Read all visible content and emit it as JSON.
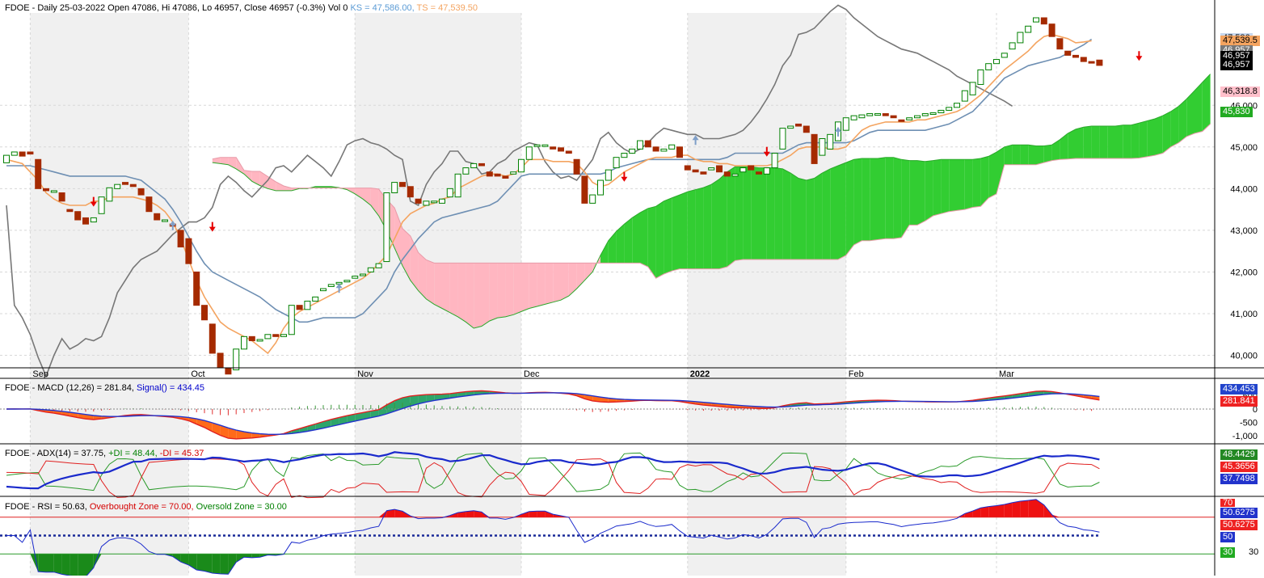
{
  "colors": {
    "up_candle": "#008000",
    "down_candle": "#a52a00",
    "cloud_bull": "#32cd32",
    "cloud_bear": "#ffb6c1",
    "kijun": "#6e8fb3",
    "tenkan": "#f4a460",
    "chikou": "#777777",
    "grid": "#d8d8d8",
    "shade": "#f0f0f0"
  },
  "price_panel": {
    "title_main": "FDOE - Daily 25-03-2022 Open 47086, Hi 47086, Lo 46957, Close 46957 (-0.3%) Vol 0",
    "title_ks": "KS = 47,586.00,",
    "title_ts": "TS = 47,539.50",
    "price_tags": [
      {
        "text": "47,586",
        "bg": "#c8d8ee",
        "fg": "#000000",
        "value": 47586
      },
      {
        "text": "47,539.5",
        "bg": "#f4a460",
        "fg": "#000000",
        "value": 47539.5
      },
      {
        "text": "46,957",
        "bg": "#777777",
        "fg": "#ffffff",
        "value": 47310
      },
      {
        "text": "46,957",
        "bg": "#000000",
        "fg": "#ffffff",
        "value": 47170
      },
      {
        "text": "46,957",
        "bg": "#000000",
        "fg": "#ffffff",
        "value": 46957
      },
      {
        "text": "46,318.8",
        "bg": "#ffc0cb",
        "fg": "#000000",
        "value": 46318.8
      },
      {
        "text": "45,830",
        "bg": "#22aa22",
        "fg": "#ffffff",
        "value": 45830
      }
    ]
  },
  "macd_panel": {
    "name": "FDOE - MACD (12,26) = 281.84,",
    "signal": "Signal() = 434.45",
    "tags": [
      "434.453",
      "281.841"
    ],
    "ticks": [
      "500",
      "0",
      "-500",
      "-1,000"
    ]
  },
  "adx_panel": {
    "name": "FDOE - ADX(14) = 37.75,",
    "pdi": "+DI = 48.44,",
    "mdi": "-DI = 45.37",
    "tags": [
      "48.4429",
      "45.3656",
      "37.7498"
    ]
  },
  "rsi_panel": {
    "name": "FDOE - RSI = 50.63,",
    "ob": "Overbought Zone = 70.00,",
    "os": "Oversold Zone = 30.00",
    "tags": [
      "70",
      "50.6275",
      "50.6275",
      "50",
      "30"
    ],
    "tick_30": "30"
  },
  "chart_data": {
    "type": "candlestick",
    "symbol": "FDOE",
    "interval": "Daily",
    "x_tick_labels": [
      "Sep",
      "Oct",
      "Nov",
      "Dec",
      "2022",
      "Feb",
      "Mar"
    ],
    "y_tick_labels": [
      "40,000",
      "41,000",
      "42,000",
      "43,000",
      "44,000",
      "45,000",
      "46,000"
    ],
    "ylim": [
      39700,
      48100
    ],
    "candles": [
      {
        "o": 44620,
        "c": 44800
      },
      {
        "o": 44800,
        "c": 44880
      },
      {
        "o": 44880,
        "c": 44780
      },
      {
        "o": 44880,
        "c": 44830
      },
      {
        "o": 44700,
        "c": 44000
      },
      {
        "o": 44000,
        "c": 43950
      },
      {
        "o": 43950,
        "c": 43950
      },
      {
        "o": 43900,
        "c": 43700
      },
      {
        "o": 43500,
        "c": 43450
      },
      {
        "o": 43450,
        "c": 43250
      },
      {
        "o": 43300,
        "c": 43150
      },
      {
        "o": 43200,
        "c": 43300
      },
      {
        "o": 43400,
        "c": 43800
      },
      {
        "o": 43700,
        "c": 44020
      },
      {
        "o": 44000,
        "c": 44100
      },
      {
        "o": 44150,
        "c": 44100
      },
      {
        "o": 44100,
        "c": 44050
      },
      {
        "o": 44000,
        "c": 43850
      },
      {
        "o": 43800,
        "c": 43450
      },
      {
        "o": 43400,
        "c": 43250
      },
      {
        "o": 43250,
        "c": 43250
      },
      {
        "o": 43150,
        "c": 43100
      },
      {
        "o": 43000,
        "c": 42600
      },
      {
        "o": 42800,
        "c": 42200
      },
      {
        "o": 42000,
        "c": 41200
      },
      {
        "o": 41200,
        "c": 40850
      },
      {
        "o": 40750,
        "c": 40050
      },
      {
        "o": 40050,
        "c": 39700
      },
      {
        "o": 39700,
        "c": 39550
      },
      {
        "o": 39650,
        "c": 40150
      },
      {
        "o": 40150,
        "c": 40450
      },
      {
        "o": 40450,
        "c": 40350
      },
      {
        "o": 40350,
        "c": 40380
      },
      {
        "o": 40400,
        "c": 40500
      },
      {
        "o": 40500,
        "c": 40450
      },
      {
        "o": 40450,
        "c": 40500
      },
      {
        "o": 40500,
        "c": 41200
      },
      {
        "o": 41200,
        "c": 41100
      },
      {
        "o": 41100,
        "c": 41300
      },
      {
        "o": 41300,
        "c": 41400
      },
      {
        "o": 41550,
        "c": 41600
      },
      {
        "o": 41650,
        "c": 41700
      },
      {
        "o": 41750,
        "c": 41750
      },
      {
        "o": 41800,
        "c": 41800
      },
      {
        "o": 41850,
        "c": 41900
      },
      {
        "o": 41950,
        "c": 41950
      },
      {
        "o": 42000,
        "c": 42100
      },
      {
        "o": 42100,
        "c": 42200
      },
      {
        "o": 42250,
        "c": 43900
      },
      {
        "o": 43900,
        "c": 44150
      },
      {
        "o": 44150,
        "c": 44050
      },
      {
        "o": 44050,
        "c": 43800
      },
      {
        "o": 43750,
        "c": 43650
      },
      {
        "o": 43600,
        "c": 43700
      },
      {
        "o": 43700,
        "c": 43700
      },
      {
        "o": 43650,
        "c": 43750
      },
      {
        "o": 43800,
        "c": 44000
      },
      {
        "o": 43800,
        "c": 44350
      },
      {
        "o": 44350,
        "c": 44500
      },
      {
        "o": 44500,
        "c": 44600
      },
      {
        "o": 44600,
        "c": 44550
      },
      {
        "o": 44400,
        "c": 44300
      },
      {
        "o": 44350,
        "c": 44300
      },
      {
        "o": 44300,
        "c": 44250
      },
      {
        "o": 44350,
        "c": 44400
      },
      {
        "o": 44400,
        "c": 44700
      },
      {
        "o": 44700,
        "c": 45000
      },
      {
        "o": 45050,
        "c": 45050
      },
      {
        "o": 45050,
        "c": 45050
      },
      {
        "o": 45000,
        "c": 44950
      },
      {
        "o": 44980,
        "c": 44900
      },
      {
        "o": 44900,
        "c": 44850
      },
      {
        "o": 44700,
        "c": 44350
      },
      {
        "o": 44300,
        "c": 43650
      },
      {
        "o": 43650,
        "c": 43850
      },
      {
        "o": 43850,
        "c": 44200
      },
      {
        "o": 44200,
        "c": 44450
      },
      {
        "o": 44500,
        "c": 44750
      },
      {
        "o": 44750,
        "c": 44850
      },
      {
        "o": 44850,
        "c": 44950
      },
      {
        "o": 44950,
        "c": 45150
      },
      {
        "o": 45150,
        "c": 45000
      },
      {
        "o": 45000,
        "c": 44900
      },
      {
        "o": 44900,
        "c": 44950
      },
      {
        "o": 44950,
        "c": 45050
      },
      {
        "o": 45000,
        "c": 44750
      },
      {
        "o": 44550,
        "c": 44450
      },
      {
        "o": 44450,
        "c": 44400
      },
      {
        "o": 44400,
        "c": 44350
      },
      {
        "o": 44450,
        "c": 44500
      },
      {
        "o": 44550,
        "c": 44400
      },
      {
        "o": 44400,
        "c": 44300
      },
      {
        "o": 44300,
        "c": 44350
      },
      {
        "o": 44400,
        "c": 44500
      },
      {
        "o": 44550,
        "c": 44450
      },
      {
        "o": 44400,
        "c": 44350
      },
      {
        "o": 44350,
        "c": 44500
      },
      {
        "o": 44500,
        "c": 44850
      },
      {
        "o": 44950,
        "c": 45450
      },
      {
        "o": 45450,
        "c": 45500
      },
      {
        "o": 45550,
        "c": 45500
      },
      {
        "o": 45500,
        "c": 45350
      },
      {
        "o": 45300,
        "c": 44600
      },
      {
        "o": 44800,
        "c": 45200
      },
      {
        "o": 44950,
        "c": 45300
      },
      {
        "o": 45150,
        "c": 45600
      },
      {
        "o": 45400,
        "c": 45700
      },
      {
        "o": 45650,
        "c": 45750
      },
      {
        "o": 45700,
        "c": 45770
      },
      {
        "o": 45750,
        "c": 45800
      },
      {
        "o": 45800,
        "c": 45800
      },
      {
        "o": 45800,
        "c": 45750
      },
      {
        "o": 45750,
        "c": 45700
      },
      {
        "o": 45650,
        "c": 45620
      },
      {
        "o": 45650,
        "c": 45700
      },
      {
        "o": 45700,
        "c": 45750
      },
      {
        "o": 45750,
        "c": 45800
      },
      {
        "o": 45800,
        "c": 45820
      },
      {
        "o": 45820,
        "c": 45880
      },
      {
        "o": 45880,
        "c": 45950
      },
      {
        "o": 45950,
        "c": 46050
      },
      {
        "o": 46100,
        "c": 46350
      },
      {
        "o": 46250,
        "c": 46550
      },
      {
        "o": 46500,
        "c": 46850
      },
      {
        "o": 46850,
        "c": 47000
      },
      {
        "o": 47000,
        "c": 47100
      },
      {
        "o": 47150,
        "c": 47250
      },
      {
        "o": 47350,
        "c": 47500
      },
      {
        "o": 47500,
        "c": 47750
      },
      {
        "o": 47750,
        "c": 47900
      },
      {
        "o": 48000,
        "c": 48100
      },
      {
        "o": 48100,
        "c": 47950
      },
      {
        "o": 47950,
        "c": 47650
      },
      {
        "o": 47600,
        "c": 47350
      },
      {
        "o": 47300,
        "c": 47200
      },
      {
        "o": 47200,
        "c": 47150
      },
      {
        "o": 47150,
        "c": 47050
      },
      {
        "o": 47050,
        "c": 47020
      },
      {
        "o": 47086,
        "c": 46957
      }
    ],
    "tenkan": [
      44700,
      44650,
      44600,
      44400,
      44200,
      43900,
      43750,
      43650,
      43600,
      43600,
      43600,
      43700,
      43700,
      43800,
      43800,
      43800,
      43800,
      43750,
      43700,
      43600,
      43450,
      43200,
      42800,
      42300,
      41800,
      41400,
      41100,
      40800,
      40650,
      40550,
      40450,
      40350,
      40200,
      40050,
      40300,
      40650,
      40900,
      41050,
      41150,
      41250,
      41350,
      41450,
      41550,
      41650,
      41750,
      41850,
      42000,
      42200,
      42400,
      42800,
      43200,
      43400,
      43500,
      43600,
      43650,
      43750,
      43800,
      44000,
      44100,
      44200,
      44300,
      44350,
      44350,
      44300,
      44350,
      44500,
      44700,
      44700,
      44700,
      44650,
      44650,
      44650,
      44600,
      44400,
      44150,
      44050,
      44100,
      44250,
      44400,
      44500,
      44600,
      44700,
      44750,
      44750,
      44750,
      44800,
      44800,
      44700,
      44650,
      44650,
      44600,
      44600,
      44550,
      44550,
      44550,
      44550,
      44550,
      44600,
      44700,
      44800,
      44950,
      45000,
      45000,
      45000,
      44950,
      44950,
      45000,
      45200,
      45400,
      45500,
      45550,
      45600,
      45600,
      45600,
      45600,
      45650,
      45650,
      45700,
      45750,
      45800,
      45850,
      45950,
      46100,
      46250,
      46450,
      46650,
      46850,
      47000,
      47150,
      47300,
      47500,
      47650,
      47700,
      47650,
      47600,
      47500,
      47520,
      47550
    ],
    "kijun": [
      44550,
      44550,
      44550,
      44550,
      44500,
      44450,
      44400,
      44350,
      44300,
      44300,
      44300,
      44300,
      44300,
      44300,
      44300,
      44300,
      44250,
      44200,
      44050,
      43900,
      43750,
      43500,
      43200,
      42850,
      42500,
      42200,
      42000,
      41900,
      41800,
      41700,
      41600,
      41500,
      41400,
      41250,
      41100,
      41000,
      40900,
      40800,
      40800,
      40850,
      40900,
      40900,
      40900,
      40900,
      40900,
      41000,
      41200,
      41400,
      41600,
      42000,
      42300,
      42550,
      42800,
      43000,
      43200,
      43300,
      43350,
      43400,
      43450,
      43500,
      43550,
      43600,
      43700,
      43900,
      44100,
      44300,
      44350,
      44350,
      44350,
      44350,
      44350,
      44350,
      44350,
      44350,
      44350,
      44350,
      44400,
      44500,
      44550,
      44600,
      44650,
      44700,
      44700,
      44700,
      44700,
      44700,
      44700,
      44700,
      44700,
      44700,
      44700,
      44750,
      44850,
      44850,
      44850,
      44850,
      44850,
      44850,
      44850,
      44950,
      45050,
      45100,
      45100,
      45100,
      45100,
      45100,
      45100,
      45150,
      45250,
      45350,
      45400,
      45400,
      45400,
      45400,
      45400,
      45400,
      45400,
      45450,
      45500,
      45550,
      45650,
      45750,
      45850,
      46050,
      46250,
      46450,
      46650,
      46750,
      46850,
      46950,
      47000,
      47050,
      47100,
      47150,
      47250,
      47350,
      47450,
      47586
    ],
    "chikou": [
      43600,
      41200,
      40900,
      40500,
      39950,
      39500,
      40000,
      40400,
      40150,
      40250,
      40400,
      40350,
      40450,
      40900,
      41500,
      41800,
      42100,
      42300,
      42400,
      42500,
      42700,
      42900,
      43050,
      43200,
      43200,
      43300,
      43550,
      44100,
      44300,
      44150,
      43950,
      43800,
      44000,
      44200,
      44500,
      44550,
      44400,
      44600,
      44800,
      44650,
      44500,
      44300,
      44650,
      45050,
      45150,
      45200,
      45100,
      45050,
      44950,
      44800,
      44700,
      43700,
      43600,
      44100,
      44400,
      44600,
      44900,
      44900,
      44650,
      44600,
      44350,
      44400,
      44600,
      44700,
      44900,
      45000,
      45100,
      45050,
      44650,
      44400,
      44250,
      44300,
      44200,
      44450,
      44700,
      45200,
      45350,
      45100,
      44950,
      44850,
      44950,
      45100,
      45300,
      45450,
      45400,
      45350,
      45300,
      45300,
      45200,
      45200,
      45200,
      45250,
      45300,
      45400,
      45600,
      45850,
      46150,
      46500,
      46950,
      47200,
      47700,
      47750,
      47850,
      48050,
      48250,
      48400,
      48300,
      48100,
      47950,
      47800,
      47650,
      47550,
      47450,
      47350,
      47300,
      47250,
      47150,
      47050,
      46950,
      46850,
      46700,
      46600,
      46500,
      46400,
      46300,
      46200,
      46100,
      45980
    ]
  }
}
